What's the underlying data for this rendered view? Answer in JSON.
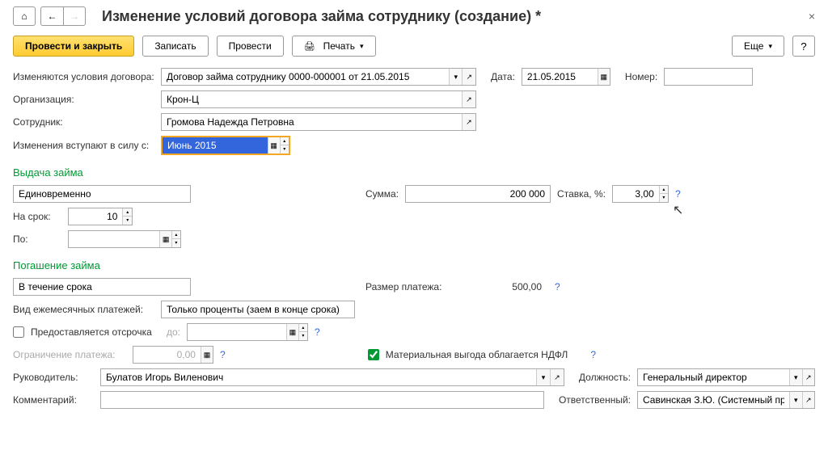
{
  "title": "Изменение условий договора займа сотруднику (создание) *",
  "toolbar": {
    "submit_close": "Провести и закрыть",
    "save": "Записать",
    "submit": "Провести",
    "print": "Печать",
    "more": "Еще",
    "help": "?"
  },
  "fields": {
    "contract_changes_label": "Изменяются условия договора:",
    "contract_changes_value": "Договор займа сотруднику 0000-000001 от 21.05.2015",
    "date_label": "Дата:",
    "date_value": "21.05.2015",
    "number_label": "Номер:",
    "number_value": "",
    "organization_label": "Организация:",
    "organization_value": "Крон-Ц",
    "employee_label": "Сотрудник:",
    "employee_value": "Громова Надежда Петровна",
    "effective_label": "Изменения вступают в силу с:",
    "effective_value": "Июнь 2015"
  },
  "loan_issue": {
    "section_title": "Выдача займа",
    "type_value": "Единовременно",
    "sum_label": "Сумма:",
    "sum_value": "200 000",
    "rate_label": "Ставка, %:",
    "rate_value": "3,00",
    "term_label": "На срок:",
    "term_value": "10",
    "until_label": "По:",
    "until_value": ""
  },
  "loan_repay": {
    "section_title": "Погашение займа",
    "type_value": "В течение срока",
    "payment_size_label": "Размер платежа:",
    "payment_size_value": "500,00",
    "monthly_type_label": "Вид ежемесячных платежей:",
    "monthly_type_value": "Только проценты (заем в конце срока)",
    "deferral_label": "Предоставляется отсрочка",
    "deferral_until_label": "до:",
    "deferral_until_value": "",
    "payment_limit_label": "Ограничение платежа:",
    "payment_limit_value": "0,00",
    "tax_label": "Материальная выгода облагается НДФЛ"
  },
  "footer": {
    "manager_label": "Руководитель:",
    "manager_value": "Булатов Игорь Виленович",
    "position_label": "Должность:",
    "position_value": "Генеральный директор",
    "comment_label": "Комментарий:",
    "comment_value": "",
    "responsible_label": "Ответственный:",
    "responsible_value": "Савинская З.Ю. (Системный прог"
  }
}
